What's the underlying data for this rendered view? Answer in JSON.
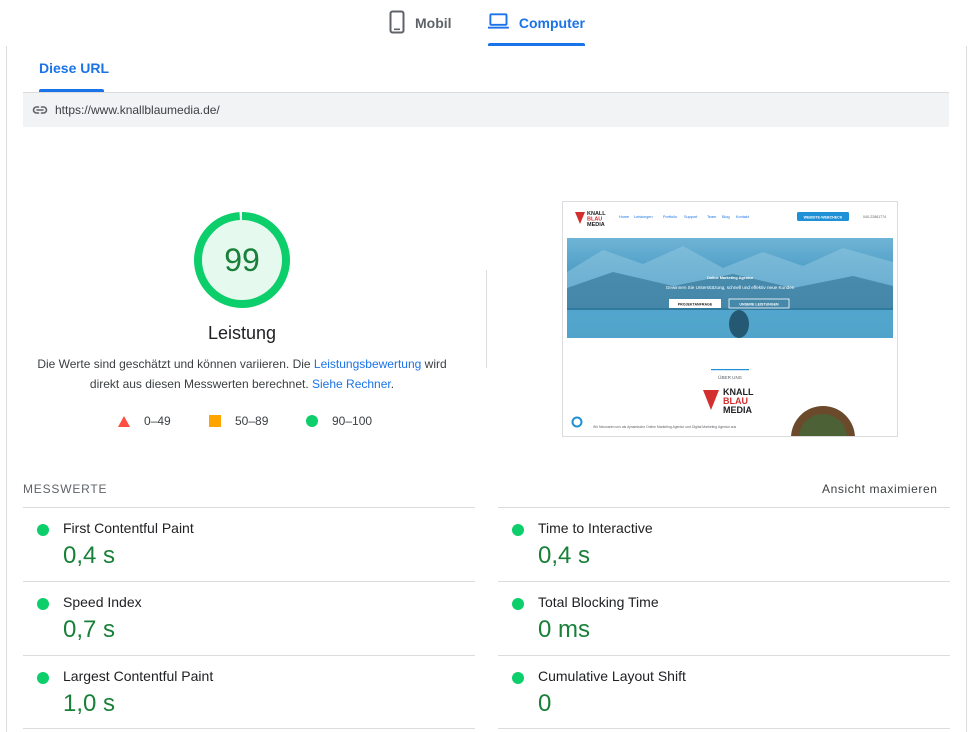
{
  "device_tabs": [
    {
      "label": "Mobil",
      "icon": "smartphone-icon",
      "selected": false
    },
    {
      "label": "Computer",
      "icon": "laptop-icon",
      "selected": true
    }
  ],
  "url_tab": {
    "label": "Diese URL"
  },
  "url_bar": {
    "url": "https://www.knallblaumedia.de/",
    "icon": "link-icon"
  },
  "score": {
    "value": "99",
    "fraction": 0.99,
    "label": "Leistung",
    "desc_prefix": "Die Werte sind geschätzt und können variieren. Die ",
    "desc_link1": "Leistungsbewertung",
    "desc_middle": " wird direkt aus diesen Messwerten berechnet. ",
    "desc_link2": "Siehe Rechner",
    "desc_suffix": ".",
    "colors": {
      "pass": "#0cce6b",
      "pass_text": "#188038",
      "average": "#ffa400",
      "fail": "#ff4e42"
    }
  },
  "legend": [
    {
      "shape": "triangle",
      "range": "0–49"
    },
    {
      "shape": "square",
      "range": "50–89"
    },
    {
      "shape": "circle",
      "range": "90–100"
    }
  ],
  "thumbnail": {
    "logo_lines": [
      "KNALL",
      "BLAU",
      "MEDIA"
    ],
    "nav": [
      "Home",
      "Leistungen",
      "Portfolio",
      "Support",
      "Team",
      "Blog",
      "Kontakt"
    ],
    "cta": "WEBSITE-WEBCHECK",
    "phone": "040-22861774",
    "hero_kicker": "Online Marketing Agentur",
    "hero_text": "Gewinnen Sie Unterstützung, schnell und effektiv neue Kunden",
    "hero_btn1": "PROJEKTANFRAGE",
    "hero_btn2": "UNSERE LEISTUNGEN",
    "about_title": "ÜBER UNS",
    "about_text": "Wir Neuwaren uns als dynamische Online Marketing Agentur und Digital Marketing Agentur aus"
  },
  "metrics": {
    "title": "MESSWERTE",
    "expand_label": "Ansicht maximieren",
    "items": [
      {
        "name": "First Contentful Paint",
        "value": "0,4 s"
      },
      {
        "name": "Time to Interactive",
        "value": "0,4 s"
      },
      {
        "name": "Speed Index",
        "value": "0,7 s"
      },
      {
        "name": "Total Blocking Time",
        "value": "0 ms"
      },
      {
        "name": "Largest Contentful Paint",
        "value": "1,0 s"
      },
      {
        "name": "Cumulative Layout Shift",
        "value": "0"
      }
    ]
  }
}
